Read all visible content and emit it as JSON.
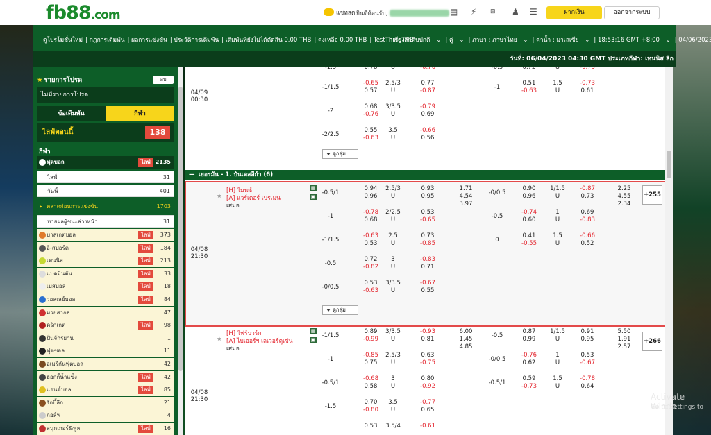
{
  "header": {
    "logo_main": "fb88",
    "logo_suffix": ".com",
    "chat_label": "แชทสด",
    "welcome_label": "ยินดีต้อนรับ,",
    "deposit_label": "ฝากเงิน",
    "logout_label": "ออกจากระบบ"
  },
  "nav": {
    "links": [
      "ดูโปรโมชั่นใหม่",
      "กฎการเดิมพัน",
      "ผลการแข่งขัน",
      "ประวัติการเดิมพัน",
      "เดิมพันที่ยังไม่ได้ตัดสิน 0.00 THB",
      "คงเหลือ 0.00 THB",
      "TestThingTHB"
    ],
    "right": [
      "เรียงลำดับปกติ",
      "คู่",
      "ภาษา : ภาษาไทย",
      "ค่าน้ำ : มาเลเซีย",
      "18:53:16 GMT +8:00",
      "04/06/2023"
    ]
  },
  "infoline": "วันที่: 06/04/2023 04:30 GMT ประเภทกีฬา: เทนนิส ลีก",
  "sidebar": {
    "fav_title": "รายการโปรด",
    "fav_btn": "ลบ",
    "no_fav": "ไม่มีรายการโปรด",
    "tab_bet": "ข้อเดิมพัน",
    "tab_sport": "กีฬา",
    "live_now": "ไลฟ์ตอนนี้",
    "live_count": "138",
    "sports_heading": "กีฬา",
    "live_badge": "ไลฟ์",
    "football": {
      "label": "ฟุตบอล",
      "count": "2135"
    },
    "sub": [
      {
        "label": "ไลฟ์",
        "count": "31"
      },
      {
        "label": "วันนี้",
        "count": "401"
      }
    ],
    "outright": {
      "label": "ตลาดก่อนการแข่งขัน",
      "count": "1703"
    },
    "outright2": {
      "label": "ทายผลผู้ชนะล่วงหน้า",
      "count": "31"
    },
    "sports": [
      {
        "label": "บาสเกตบอล",
        "count": "373",
        "live": true,
        "color": "#e07a2a"
      },
      {
        "label": "อี-สปอร์ต",
        "count": "184",
        "live": true,
        "color": "#555555"
      },
      {
        "label": "เทนนิส",
        "count": "213",
        "live": true,
        "color": "#c5d833"
      },
      {
        "label": "แบดมินตัน",
        "count": "33",
        "live": true,
        "color": "#dddddd"
      },
      {
        "label": "เบสบอล",
        "count": "18",
        "live": true,
        "color": "#eeeeee"
      },
      {
        "label": "วอลเลย์บอล",
        "count": "84",
        "live": true,
        "color": "#2a6fd0"
      },
      {
        "label": "มวยสากล",
        "count": "47",
        "live": false,
        "color": "#d03030"
      },
      {
        "label": "คริกเกต",
        "count": "98",
        "live": true,
        "color": "#b02020"
      },
      {
        "label": "ปั่นจักรยาน",
        "count": "1",
        "live": false,
        "color": "#333333"
      },
      {
        "label": "ฟุตซอล",
        "count": "11",
        "live": false,
        "color": "#222222"
      },
      {
        "label": "อเมริกันฟุตบอล",
        "count": "42",
        "live": false,
        "color": "#7a4a20"
      },
      {
        "label": "ฮอกกี้น้ำแข็ง",
        "count": "42",
        "live": true,
        "color": "#444444"
      },
      {
        "label": "แฮนด์บอล",
        "count": "85",
        "live": true,
        "color": "#e0c020"
      },
      {
        "label": "รักบี้ลีก",
        "count": "21",
        "live": false,
        "color": "#8a5020"
      },
      {
        "label": "กอล์ฟ",
        "count": "4",
        "live": false,
        "color": "#cccccc"
      },
      {
        "label": "สนุกเกอร์&พูล",
        "count": "16",
        "live": true,
        "color": "#c03030"
      }
    ]
  },
  "main": {
    "more_label": "ดูกลุ่ม",
    "league": "เยอรมัน - 1. บันเดสลีก้า (6)",
    "match_top": {
      "date": "04/09",
      "time": "00:30",
      "rows": [
        {
          "h1": "-1/1.5",
          "o1a": "-0.65",
          "o1b": "0.57",
          "h2": "2.5/3",
          "u": "U",
          "o2a": "0.77",
          "o2b": "-0.87",
          "h3": "-1",
          "o3a": "0.51",
          "o3b": "-0.63",
          "h4": "1.5",
          "u2": "U",
          "o4a": "-0.73",
          "o4b": "0.61"
        },
        {
          "h1": "-2",
          "o1a": "0.68",
          "o1b": "-0.76",
          "h2": "3/3.5",
          "u": "U",
          "o2a": "-0.79",
          "o2b": "0.69"
        },
        {
          "h1": "-2/2.5",
          "o1a": "0.55",
          "o1b": "-0.63",
          "h2": "3.5",
          "u": "U",
          "o2a": "-0.66",
          "o2b": "0.56"
        }
      ],
      "partial": {
        "h1": "-1.5",
        "o1": "0.78",
        "u": "U",
        "o2": "-0.76",
        "h3": "-0.5",
        "o3": "0.72",
        "u2": "U",
        "o4": "-0.75"
      }
    },
    "match1": {
      "date": "04/08",
      "time": "21:30",
      "home": "ไมนซ์",
      "away": "แวร์เดอร์ เบรเมน",
      "draw": "เสมอ",
      "x12": [
        "1.71",
        "4.54",
        "3.97"
      ],
      "x12b": [
        "2.25",
        "4.55",
        "2.34"
      ],
      "plus": "+255",
      "rows": [
        {
          "h1": "-0.5/1",
          "o1a": "0.94",
          "o1b": "0.96",
          "h2": "2.5/3",
          "u": "U",
          "o2a": "0.93",
          "o2b": "0.95",
          "h3": "-0/0.5",
          "o3a": "0.90",
          "o3b": "0.96",
          "h4": "1/1.5",
          "u2": "U",
          "o4a": "-0.87",
          "o4b": "0.73"
        },
        {
          "h1": "-1",
          "o1a": "-0.78",
          "o1b": "0.68",
          "h2": "2/2.5",
          "u": "U",
          "o2a": "0.53",
          "o2b": "-0.65",
          "h3": "-0.5",
          "o3a": "-0.74",
          "o3b": "0.60",
          "h4": "1",
          "u2": "U",
          "o4a": "0.69",
          "o4b": "-0.83"
        },
        {
          "h1": "-1/1.5",
          "o1a": "-0.63",
          "o1b": "0.53",
          "h2": "2.5",
          "u": "U",
          "o2a": "0.73",
          "o2b": "-0.85",
          "h3": "0",
          "o3a": "0.41",
          "o3b": "-0.55",
          "h4": "1.5",
          "u2": "U",
          "o4a": "-0.66",
          "o4b": "0.52"
        },
        {
          "h1": "-0.5",
          "o1a": "0.72",
          "o1b": "-0.82",
          "h2": "3",
          "u": "U",
          "o2a": "-0.83",
          "o2b": "0.71"
        },
        {
          "h1": "-0/0.5",
          "o1a": "0.53",
          "o1b": "-0.63",
          "h2": "3/3.5",
          "u": "U",
          "o2a": "-0.67",
          "o2b": "0.55"
        }
      ]
    },
    "match2": {
      "date": "04/08",
      "time": "21:30",
      "home": "ไฟร์บวร์ก",
      "away": "ไบเออร์ฯ เลเวอร์คูเซ่น",
      "draw": "เสมอ",
      "x12": [
        "6.00",
        "1.45",
        "4.85"
      ],
      "x12b": [
        "5.50",
        "1.91",
        "2.57"
      ],
      "plus": "+266",
      "rows": [
        {
          "h1": "-1/1.5",
          "o1a": "0.89",
          "o1b": "-0.99",
          "h2": "3/3.5",
          "u": "U",
          "o2a": "-0.93",
          "o2b": "0.81",
          "h3": "-0.5",
          "o3a": "0.87",
          "o3b": "0.99",
          "h4": "1/1.5",
          "u2": "U",
          "o4a": "0.91",
          "o4b": "0.95"
        },
        {
          "h1": "-1",
          "o1a": "-0.85",
          "o1b": "0.75",
          "h2": "2.5/3",
          "u": "U",
          "o2a": "0.63",
          "o2b": "-0.75",
          "h3": "-0/0.5",
          "o3a": "-0.76",
          "o3b": "0.62",
          "h4": "1",
          "u2": "U",
          "o4a": "0.53",
          "o4b": "-0.67"
        },
        {
          "h1": "-0.5/1",
          "o1a": "-0.68",
          "o1b": "0.58",
          "h2": "3",
          "u": "U",
          "o2a": "0.80",
          "o2b": "-0.92",
          "h3": "-0.5/1",
          "o3a": "0.59",
          "o3b": "-0.73",
          "h4": "1.5",
          "u2": "U",
          "o4a": "-0.78",
          "o4b": "0.64"
        },
        {
          "h1": "-1.5",
          "o1a": "0.70",
          "o1b": "-0.80",
          "h2": "3.5",
          "u": "U",
          "o2a": "-0.77",
          "o2b": "0.65"
        },
        {
          "h1": "",
          "o1a": "0.53",
          "o1b": "",
          "h2": "3.5/4",
          "u": "",
          "o2a": "-0.61",
          "o2b": ""
        }
      ]
    }
  },
  "windows": {
    "line1": "Activate Windo",
    "line2": "Go to Settings to"
  }
}
